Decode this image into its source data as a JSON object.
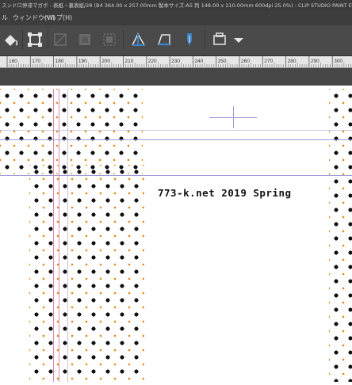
{
  "window": {
    "title": "スンドロ停滞マガポ - 表紙・裏表紙/28 (B4 364.00 x 257.00mm 製本サイズ:A5 判 148.00 x 210.00mm 600dpi 25.0%) - CLIP STUDIO PAINT EX"
  },
  "menu": {
    "items": [
      "ル",
      "ウィンドウ(W)",
      "ヘルプ(H)"
    ]
  },
  "toolbar": {
    "buttons": [
      "fill-icon",
      "transform-icon",
      "layer-disabled-icon",
      "clear-disabled-icon",
      "select-disabled-icon",
      "ruler-perspective-icon",
      "ruler-frame-icon",
      "pen-stabilize-icon",
      "tools-dropdown-icon"
    ]
  },
  "ruler": {
    "labels": [
      "160",
      "170",
      "180",
      "190",
      "200",
      "210",
      "220",
      "230",
      "240",
      "250",
      "260",
      "270",
      "280",
      "290",
      "300"
    ]
  },
  "canvas": {
    "caption": "773-k.net 2019 Spring",
    "pattern_colors": {
      "black": "#101010",
      "orange": "#e88b1c"
    }
  },
  "colors": {
    "titlebar_bg": "#3b3b3b",
    "menubar_bg": "#3d3d3d",
    "toolbar_bg": "#4a4a4a",
    "ruler_bg": "#e6e6e6",
    "workspace_bg": "#474747",
    "accent_blue": "#3b84c8"
  }
}
